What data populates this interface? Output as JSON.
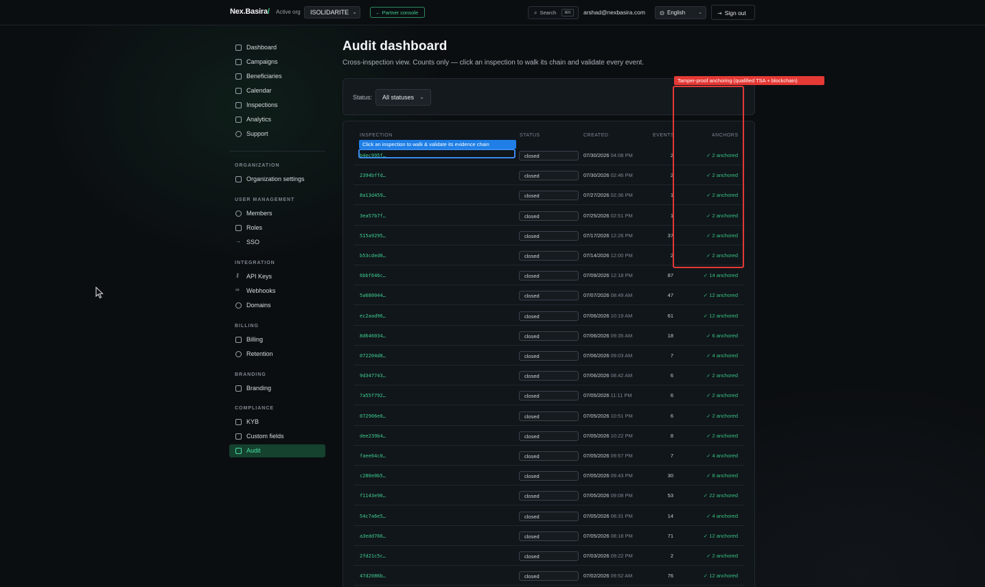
{
  "topbar": {
    "brand": "Nex.Basira",
    "brand_slash": "/",
    "active_org_label": "Active org",
    "active_org_value": "ISOLIDARITE",
    "partner_console": "← Partner console",
    "search_label": "Search",
    "search_shortcut": "⌘K",
    "user_email": "arshad@nexbasira.com",
    "language": "English",
    "sign_out": "Sign out"
  },
  "sidebar": {
    "main_items": [
      {
        "label": "Dashboard",
        "icon": "grid-icon"
      },
      {
        "label": "Campaigns",
        "icon": "flag-icon"
      },
      {
        "label": "Beneficiaries",
        "icon": "id-card-icon"
      },
      {
        "label": "Calendar",
        "icon": "calendar-icon"
      },
      {
        "label": "Inspections",
        "icon": "video-icon"
      },
      {
        "label": "Analytics",
        "icon": "bar-chart-icon"
      },
      {
        "label": "Support",
        "icon": "lifebuoy-icon"
      }
    ],
    "sections": {
      "organization": {
        "title": "ORGANIZATION",
        "items": [
          "Organization settings"
        ]
      },
      "user_management": {
        "title": "USER MANAGEMENT",
        "items": [
          "Members",
          "Roles",
          "SSO"
        ]
      },
      "integration": {
        "title": "INTEGRATION",
        "items": [
          "API Keys",
          "Webhooks",
          "Domains"
        ]
      },
      "billing": {
        "title": "BILLING",
        "items": [
          "Billing",
          "Retention"
        ]
      },
      "branding": {
        "title": "BRANDING",
        "items": [
          "Branding"
        ]
      },
      "compliance": {
        "title": "COMPLIANCE",
        "items": [
          "KYB",
          "Custom fields",
          "Audit"
        ]
      }
    },
    "active_item": "Audit"
  },
  "main": {
    "title": "Audit dashboard",
    "subtitle": "Cross-inspection view. Counts only — click an inspection to walk its chain and validate every event.",
    "filter": {
      "label": "Status:",
      "value": "All statuses"
    },
    "table": {
      "headers": {
        "inspection": "INSPECTION",
        "status": "STATUS",
        "created": "CREATED",
        "events": "EVENTS",
        "anchors": "ANCHORS"
      },
      "rows": [
        {
          "id": "b4ec995f…",
          "status": "closed",
          "date": "07/30/2026",
          "time": "04:08 PM",
          "events": "2",
          "anchors": "✓ 2 anchored"
        },
        {
          "id": "2394bffd…",
          "status": "closed",
          "date": "07/30/2026",
          "time": "02:46 PM",
          "events": "2",
          "anchors": "✓ 2 anchored"
        },
        {
          "id": "8a13d459…",
          "status": "closed",
          "date": "07/27/2026",
          "time": "02:36 PM",
          "events": "1",
          "anchors": "✓ 2 anchored"
        },
        {
          "id": "3ea57b7f…",
          "status": "closed",
          "date": "07/25/2026",
          "time": "02:51 PM",
          "events": "1",
          "anchors": "✓ 2 anchored"
        },
        {
          "id": "515a9295…",
          "status": "closed",
          "date": "07/17/2026",
          "time": "12:26 PM",
          "events": "37",
          "anchors": "✓ 2 anchored"
        },
        {
          "id": "b53cded0…",
          "status": "closed",
          "date": "07/14/2026",
          "time": "12:00 PM",
          "events": "2",
          "anchors": "✓ 2 anchored"
        },
        {
          "id": "6bbf646c…",
          "status": "closed",
          "date": "07/09/2026",
          "time": "12:18 PM",
          "events": "87",
          "anchors": "✓ 14 anchored"
        },
        {
          "id": "5a680044…",
          "status": "closed",
          "date": "07/07/2026",
          "time": "08:49 AM",
          "events": "47",
          "anchors": "✓ 12 anchored"
        },
        {
          "id": "ec2aad96…",
          "status": "closed",
          "date": "07/06/2026",
          "time": "10:19 AM",
          "events": "61",
          "anchors": "✓ 12 anchored"
        },
        {
          "id": "8d646034…",
          "status": "closed",
          "date": "07/06/2026",
          "time": "09:35 AM",
          "events": "18",
          "anchors": "✓ 6 anchored"
        },
        {
          "id": "072204d8…",
          "status": "closed",
          "date": "07/06/2026",
          "time": "09:03 AM",
          "events": "7",
          "anchors": "✓ 4 anchored"
        },
        {
          "id": "9d347743…",
          "status": "closed",
          "date": "07/06/2026",
          "time": "08:42 AM",
          "events": "6",
          "anchors": "✓ 2 anchored"
        },
        {
          "id": "7a55f792…",
          "status": "closed",
          "date": "07/05/2026",
          "time": "11:11 PM",
          "events": "6",
          "anchors": "✓ 2 anchored"
        },
        {
          "id": "072906e0…",
          "status": "closed",
          "date": "07/05/2026",
          "time": "10:51 PM",
          "events": "6",
          "anchors": "✓ 2 anchored"
        },
        {
          "id": "dee239b4…",
          "status": "closed",
          "date": "07/05/2026",
          "time": "10:22 PM",
          "events": "8",
          "anchors": "✓ 2 anchored"
        },
        {
          "id": "faee64c0…",
          "status": "closed",
          "date": "07/05/2026",
          "time": "09:57 PM",
          "events": "7",
          "anchors": "✓ 4 anchored"
        },
        {
          "id": "c280e0b5…",
          "status": "closed",
          "date": "07/05/2026",
          "time": "09:43 PM",
          "events": "30",
          "anchors": "✓ 8 anchored"
        },
        {
          "id": "f1143e90…",
          "status": "closed",
          "date": "07/05/2026",
          "time": "09:08 PM",
          "events": "53",
          "anchors": "✓ 22 anchored"
        },
        {
          "id": "54c7a6e5…",
          "status": "closed",
          "date": "07/05/2026",
          "time": "08:31 PM",
          "events": "14",
          "anchors": "✓ 4 anchored"
        },
        {
          "id": "a3edd766…",
          "status": "closed",
          "date": "07/05/2026",
          "time": "08:18 PM",
          "events": "71",
          "anchors": "✓ 12 anchored"
        },
        {
          "id": "2fd21c5c…",
          "status": "closed",
          "date": "07/03/2026",
          "time": "09:22 PM",
          "events": "2",
          "anchors": "✓ 2 anchored"
        },
        {
          "id": "47d2086b…",
          "status": "closed",
          "date": "07/02/2026",
          "time": "09:52 AM",
          "events": "76",
          "anchors": "✓ 12 anchored"
        }
      ]
    }
  },
  "annotations": {
    "inspection_tip": "Click an inspection to walk & validate its evidence chain",
    "anchoring_tip": "Tamper-proof anchoring (qualified TSA + blockchain)"
  },
  "colors": {
    "accent": "#3ecf8e",
    "highlight_red": "#e53935",
    "tooltip_blue": "#1f7fe6"
  }
}
